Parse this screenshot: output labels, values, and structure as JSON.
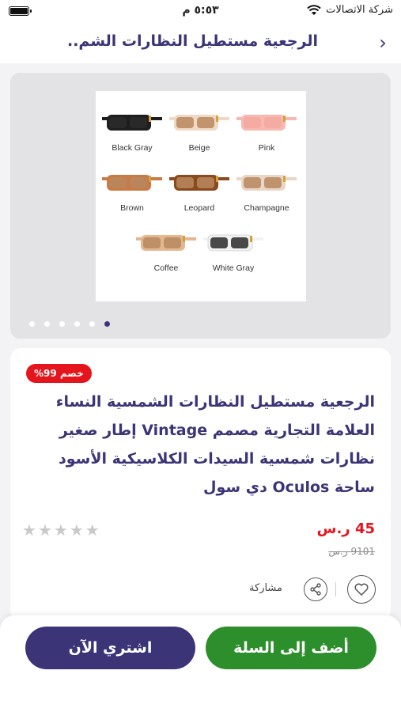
{
  "status_bar": {
    "carrier": "شركة الاتصالات",
    "time": "٥:٥٣ م"
  },
  "header": {
    "title": "الرجعية مستطيل النظارات الشم.."
  },
  "gallery": {
    "variants": [
      "Black Gray",
      "Beige",
      "Pink",
      "Brown",
      "Leopard",
      "Champagne",
      "Coffee",
      "White Gray"
    ],
    "colors": {
      "black_gray": "#1e1e1e",
      "beige": "#efd9c4",
      "pink": "#f6b8b0",
      "brown": "#c97a45",
      "leopard": "#8a4a1e",
      "champagne": "#e9d6c6",
      "coffee": "#e3b891",
      "white_gray": "#f2f2f2"
    },
    "dot_count": 6,
    "active_dot": 6
  },
  "product": {
    "discount_badge": "خصم 99%",
    "title": "الرجعية مستطيل النظارات الشمسية النساء العلامة التجارية مصمم Vintage إطار صغير نظارات شمسية السيدات الكلاسيكية الأسود ساحة Oculos دي سول",
    "price": "45 ر.س",
    "old_price": "9101 ر.س",
    "rating": 0,
    "share_label": "مشاركة"
  },
  "actions": {
    "buy_now": "اشتري الآن",
    "add_to_cart": "أضف إلى السلة"
  },
  "theme": {
    "primary": "#3b3577",
    "cart_green": "#2d8f2b",
    "sale_red": "#e4151c"
  }
}
